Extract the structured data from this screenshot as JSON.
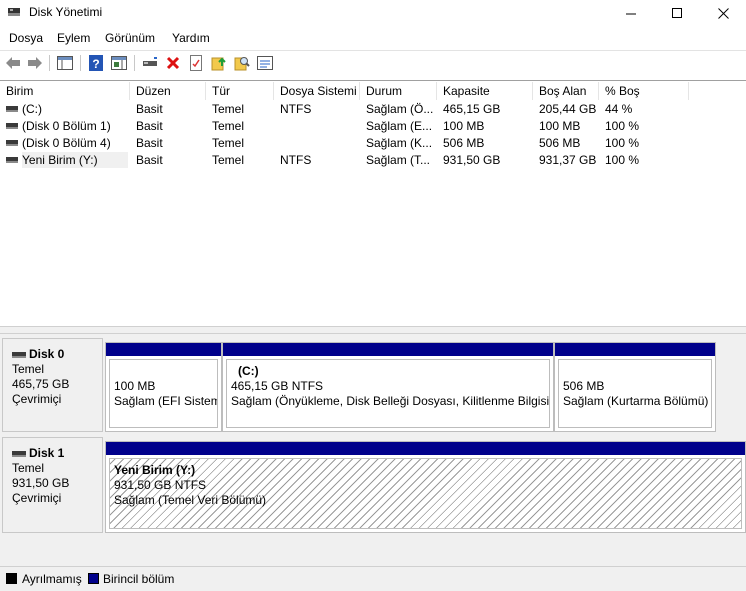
{
  "window": {
    "title": "Disk Yönetimi",
    "minimize_glyph": "—",
    "maximize_glyph": "☐",
    "close_glyph": "✕"
  },
  "menu": [
    "Dosya",
    "Eylem",
    "Görünüm",
    "Yardım"
  ],
  "toolbar": {
    "icons": [
      "back-icon",
      "forward-icon",
      "console-tree-icon",
      "help-icon",
      "action-pane-icon",
      "connect-icon",
      "delete-icon",
      "properties-icon",
      "upload-icon",
      "search-icon",
      "console-icon"
    ]
  },
  "volumes": {
    "columns": [
      "Birim",
      "Düzen",
      "Tür",
      "Dosya Sistemi",
      "Durum",
      "Kapasite",
      "Boş Alan",
      "% Boş"
    ],
    "rows": [
      {
        "name": " (C:)",
        "layout": "Basit",
        "type": "Temel",
        "fs": "NTFS",
        "status": "Sağlam (Ö...",
        "capacity": "465,15 GB",
        "free": "205,44 GB",
        "pct": "44 %"
      },
      {
        "name": "(Disk 0 Bölüm 1)",
        "layout": "Basit",
        "type": "Temel",
        "fs": "",
        "status": "Sağlam (E...",
        "capacity": "100 MB",
        "free": "100 MB",
        "pct": "100 %"
      },
      {
        "name": "(Disk 0 Bölüm 4)",
        "layout": "Basit",
        "type": "Temel",
        "fs": "",
        "status": "Sağlam (K...",
        "capacity": "506 MB",
        "free": "506 MB",
        "pct": "100 %"
      },
      {
        "name": "Yeni Birim (Y:)",
        "layout": "Basit",
        "type": "Temel",
        "fs": "NTFS",
        "status": "Sağlam (T...",
        "capacity": "931,50 GB",
        "free": "931,37 GB",
        "pct": "100 %"
      }
    ]
  },
  "disks": [
    {
      "name": "Disk 0",
      "kind": "Temel",
      "size": "465,75 GB",
      "state": "Çevrimiçi",
      "partitions": [
        {
          "title": "",
          "size": "100 MB",
          "status": "Sağlam (EFI Sistem"
        },
        {
          "title": "(C:)",
          "size": "465,15 GB NTFS",
          "status": "Sağlam (Önyükleme, Disk Belleği Dosyası, Kilitlenme Bilgisi,"
        },
        {
          "title": "",
          "size": "506 MB",
          "status": "Sağlam (Kurtarma Bölümü)"
        }
      ]
    },
    {
      "name": "Disk 1",
      "kind": "Temel",
      "size": "931,50 GB",
      "state": "Çevrimiçi",
      "partitions": [
        {
          "title": "Yeni Birim  (Y:)",
          "size": "931,50 GB NTFS",
          "status": "Sağlam (Temel Veri Bölümü)"
        }
      ]
    }
  ],
  "legend": [
    {
      "label": "Ayrılmamış",
      "color": "#000000"
    },
    {
      "label": "Birincil bölüm",
      "color": "#00008b"
    }
  ]
}
